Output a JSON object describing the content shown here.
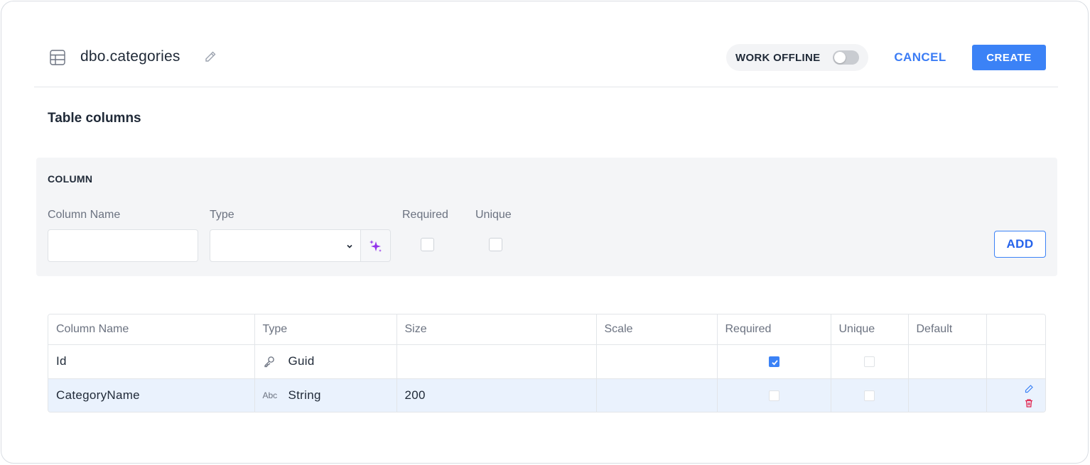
{
  "header": {
    "table_name": "dbo.categories",
    "work_offline_label": "WORK OFFLINE",
    "work_offline_enabled": false,
    "cancel_label": "CANCEL",
    "create_label": "CREATE"
  },
  "section_title": "Table columns",
  "column_form": {
    "heading": "COLUMN",
    "name_label": "Column Name",
    "name_value": "",
    "type_label": "Type",
    "type_value": "",
    "required_label": "Required",
    "required_checked": false,
    "unique_label": "Unique",
    "unique_checked": false,
    "add_label": "ADD"
  },
  "grid": {
    "headers": [
      "Column Name",
      "Type",
      "Size",
      "Scale",
      "Required",
      "Unique",
      "Default",
      ""
    ],
    "rows": [
      {
        "name": "Id",
        "type_icon": "key-icon",
        "type": "Guid",
        "size": "",
        "scale": "",
        "required": true,
        "unique": false,
        "default": ""
      },
      {
        "name": "CategoryName",
        "type_icon": "text-abc-icon",
        "type_icon_text": "Abc",
        "type": "String",
        "size": "200",
        "scale": "",
        "required": false,
        "unique": false,
        "default": "",
        "selected": true
      }
    ]
  },
  "colors": {
    "accent": "#3b82f6",
    "delete": "#e11d48",
    "ai_sparkle": "#9333ea",
    "selected_row": "#eaf2fd"
  }
}
